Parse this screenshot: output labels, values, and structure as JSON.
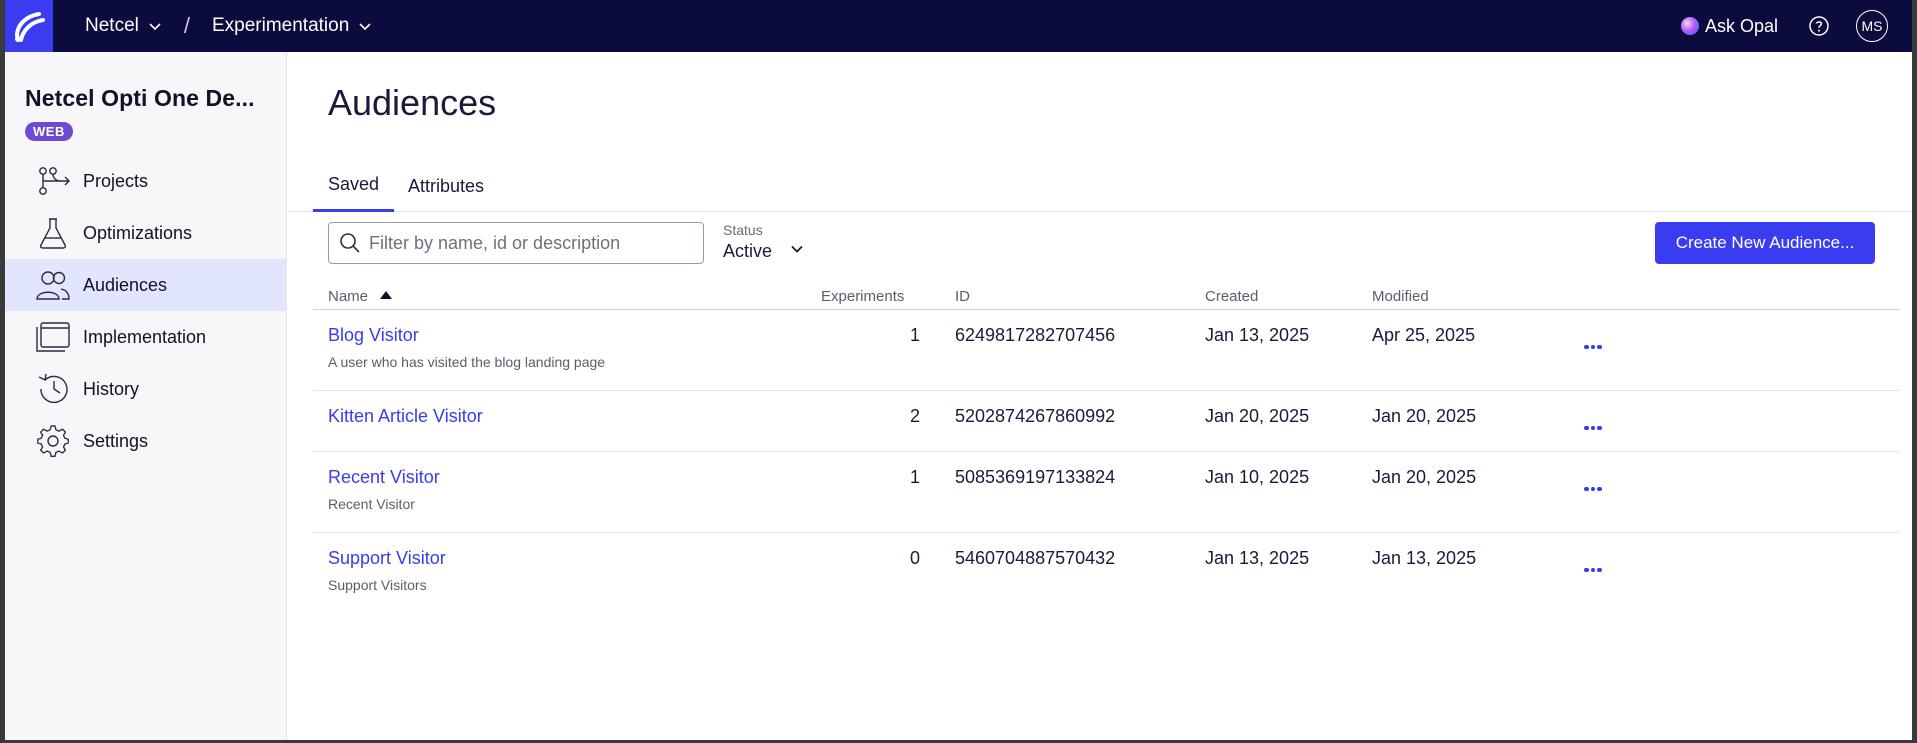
{
  "topbar": {
    "org": "Netcel",
    "product": "Experimentation",
    "separator": "/",
    "ask_opal": "Ask Opal",
    "user_initials": "MS"
  },
  "sidebar": {
    "project_name": "Netcel Opti One De...",
    "platform_badge": "WEB",
    "items": [
      {
        "label": "Projects",
        "icon": "projects-icon"
      },
      {
        "label": "Optimizations",
        "icon": "flask-icon"
      },
      {
        "label": "Audiences",
        "icon": "audiences-icon",
        "active": true
      },
      {
        "label": "Implementation",
        "icon": "implementation-icon"
      },
      {
        "label": "History",
        "icon": "history-icon"
      },
      {
        "label": "Settings",
        "icon": "gear-icon"
      }
    ]
  },
  "main": {
    "title": "Audiences",
    "tabs": [
      {
        "label": "Saved",
        "active": true
      },
      {
        "label": "Attributes",
        "active": false
      }
    ],
    "search": {
      "placeholder": "Filter by name, id or description",
      "value": ""
    },
    "status": {
      "label": "Status",
      "value": "Active"
    },
    "create_button": "Create New Audience...",
    "table": {
      "columns": [
        "Name",
        "Experiments",
        "ID",
        "Created",
        "Modified"
      ],
      "sort_column": "Name",
      "sort_direction": "ascending",
      "rows": [
        {
          "name": "Blog Visitor",
          "description": "A user who has visited the blog landing page",
          "experiments": "1",
          "id": "6249817282707456",
          "created": "Jan 13, 2025",
          "modified": "Apr 25, 2025"
        },
        {
          "name": "Kitten Article Visitor",
          "description": "",
          "experiments": "2",
          "id": "5202874267860992",
          "created": "Jan 20, 2025",
          "modified": "Jan 20, 2025"
        },
        {
          "name": "Recent Visitor",
          "description": "Recent Visitor",
          "experiments": "1",
          "id": "5085369197133824",
          "created": "Jan 10, 2025",
          "modified": "Jan 20, 2025"
        },
        {
          "name": "Support Visitor",
          "description": "Support Visitors",
          "experiments": "0",
          "id": "5460704887570432",
          "created": "Jan 13, 2025",
          "modified": "Jan 13, 2025"
        }
      ]
    }
  },
  "colors": {
    "topbar_bg": "#0b0b3d",
    "accent": "#3b3bf0",
    "badge": "#6c4bd2",
    "active_nav_bg": "#e1e6fd"
  }
}
